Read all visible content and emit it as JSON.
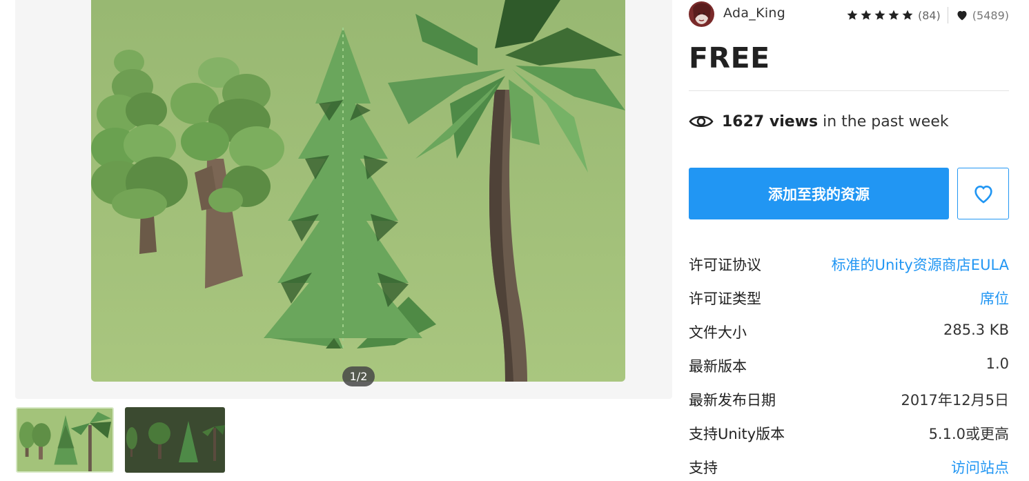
{
  "gallery": {
    "page_indicator": "1/2",
    "main_image_alt": "low poly trees",
    "thumbnails": [
      {
        "label": "thumbnail-1"
      },
      {
        "label": "thumbnail-2"
      }
    ]
  },
  "author": {
    "name": "Ada_King"
  },
  "rating": {
    "stars": 5,
    "count_text": "(84)",
    "favorites_text": "(5489)"
  },
  "price": "FREE",
  "views": {
    "count": "1627 views",
    "suffix": "in the past week"
  },
  "actions": {
    "add_label": "添加至我的资源"
  },
  "details": [
    {
      "label": "许可证协议",
      "value": "标准的Unity资源商店EULA",
      "link": true
    },
    {
      "label": "许可证类型",
      "value": "席位",
      "link": true
    },
    {
      "label": "文件大小",
      "value": "285.3 KB",
      "link": false
    },
    {
      "label": "最新版本",
      "value": "1.0",
      "link": false
    },
    {
      "label": "最新发布日期",
      "value": "2017年12月5日",
      "link": false
    },
    {
      "label": "支持Unity版本",
      "value": "5.1.0或更高",
      "link": false
    },
    {
      "label": "支持",
      "value": "访问站点",
      "link": true
    }
  ],
  "colors": {
    "accent": "#2196f3",
    "image_background": "#9fbf74"
  },
  "icons": {
    "star": "star-icon",
    "heart": "heart-icon",
    "eye": "eye-icon"
  }
}
